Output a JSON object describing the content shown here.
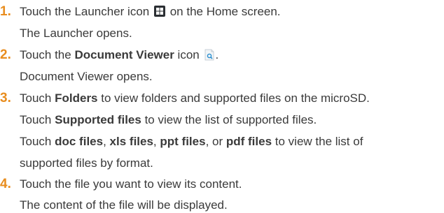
{
  "steps": [
    {
      "number": "1.",
      "line1_before": "Touch the Launcher icon",
      "launcher_icon": "launcher-icon",
      "line1_after": "on the Home screen.",
      "result": "The Launcher opens."
    },
    {
      "number": "2.",
      "line1_before": "Touch the",
      "bold": "Document Viewer",
      "line1_mid": "icon",
      "docviewer_icon": "document-viewer-icon",
      "line1_after": ".",
      "result": "Document Viewer opens."
    },
    {
      "number": "3.",
      "touch": "Touch",
      "folders": "Folders",
      "folders_after": "to view folders and supported files on the microSD.",
      "supported": "Supported files",
      "supported_after": "to view the list of supported files.",
      "doc": "doc files",
      "sep1": ",",
      "xls": "xls files",
      "sep2": ",",
      "ppt": "ppt files",
      "or": ", or",
      "pdf": "pdf files",
      "pdf_after": "to view the list of",
      "last": "supported files by format."
    },
    {
      "number": "4.",
      "line1": "Touch the file you want to view its content.",
      "result": "The content of the file will be displayed."
    }
  ],
  "colors": {
    "step_number": "#e88d1f",
    "text": "#3a3a3a"
  }
}
